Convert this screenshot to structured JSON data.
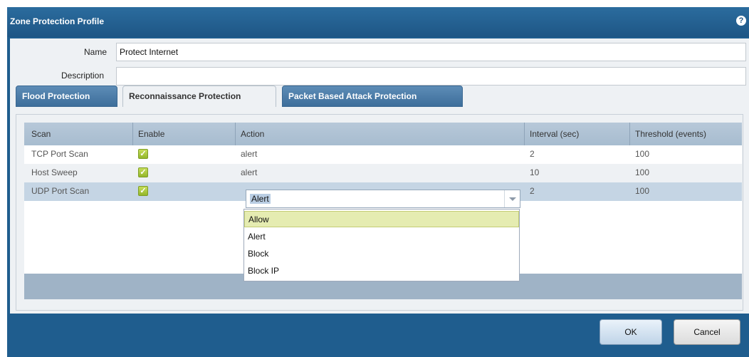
{
  "dialog": {
    "title": "Zone Protection Profile",
    "help_glyph": "?"
  },
  "form": {
    "name_label": "Name",
    "name_value": "Protect Internet",
    "description_label": "Description",
    "description_value": ""
  },
  "tabs": [
    {
      "label": "Flood Protection",
      "active": false
    },
    {
      "label": "Reconnaissance Protection",
      "active": true
    },
    {
      "label": "Packet Based Attack Protection",
      "active": false
    }
  ],
  "table": {
    "headers": [
      "Scan",
      "Enable",
      "Action",
      "Interval (sec)",
      "Threshold (events)"
    ],
    "rows": [
      {
        "scan": "TCP Port Scan",
        "enabled": true,
        "action": "alert",
        "interval": "2",
        "threshold": "100"
      },
      {
        "scan": "Host Sweep",
        "enabled": true,
        "action": "alert",
        "interval": "10",
        "threshold": "100"
      },
      {
        "scan": "UDP Port Scan",
        "enabled": true,
        "action": "Alert",
        "interval": "2",
        "threshold": "100"
      }
    ]
  },
  "action_select": {
    "value": "Alert",
    "options": [
      "Allow",
      "Alert",
      "Block",
      "Block IP"
    ],
    "highlighted": "Allow"
  },
  "buttons": {
    "ok": "OK",
    "cancel": "Cancel"
  },
  "colors": {
    "title_bar": "#1e5685",
    "checkbox": "#9cbc2e",
    "highlight_option": "#e5ecb1"
  }
}
